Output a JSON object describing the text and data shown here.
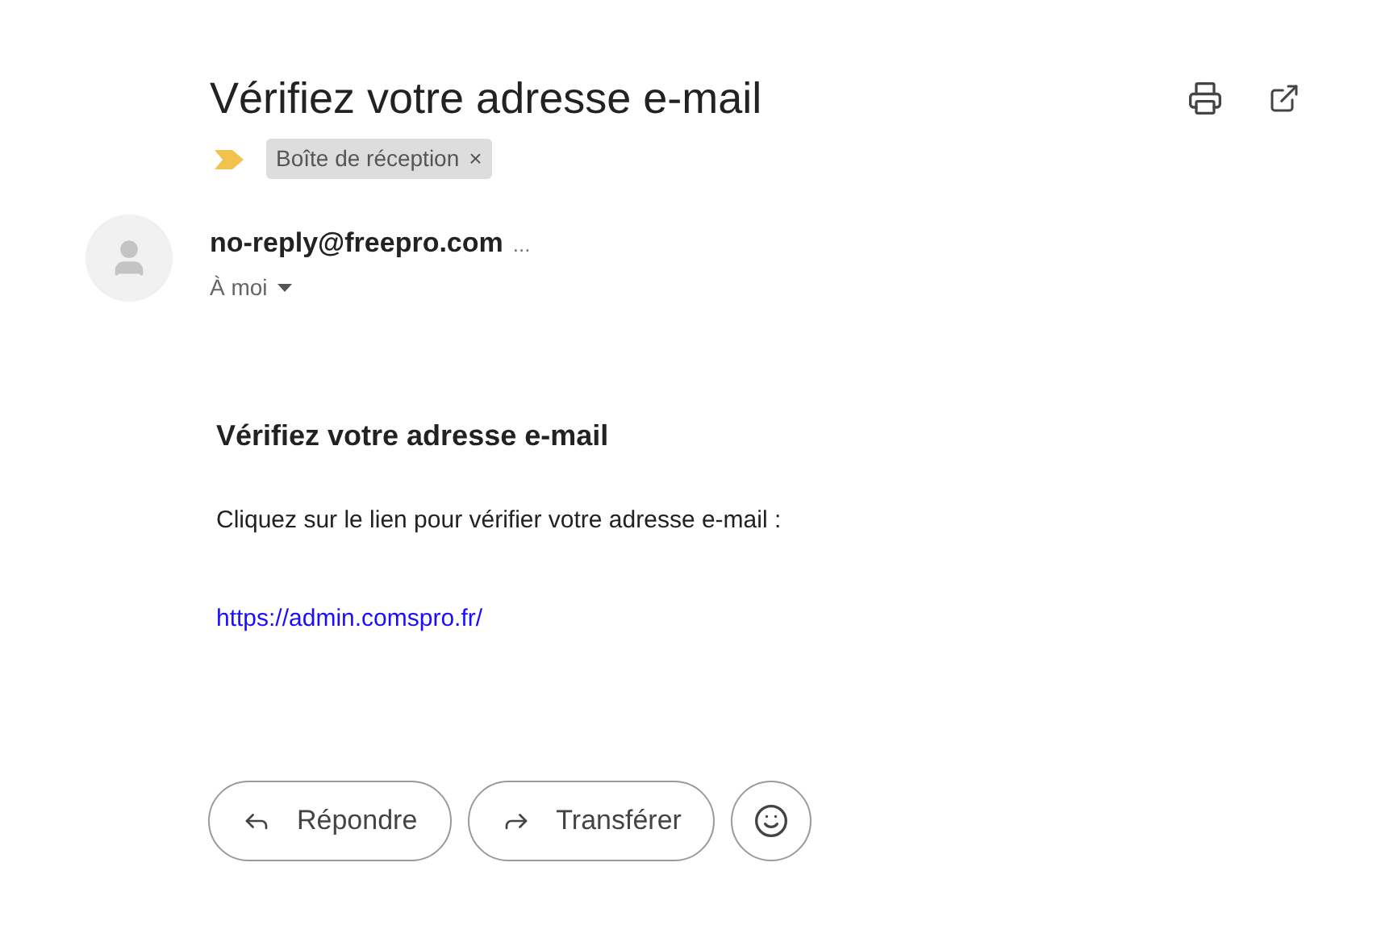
{
  "subject": "Vérifiez votre adresse e-mail",
  "label": {
    "text": "Boîte de réception",
    "remove": "×"
  },
  "sender": {
    "address": "no-reply@freepro.com",
    "more": "...",
    "recipient": "À moi"
  },
  "body": {
    "heading": "Vérifiez votre adresse e-mail",
    "text": "Cliquez sur le lien pour vérifier votre adresse e-mail :",
    "link": "https://admin.comspro.fr/"
  },
  "actions": [
    {
      "kind": "reply",
      "label": "Répondre"
    },
    {
      "kind": "forward",
      "label": "Transférer"
    },
    {
      "kind": "emoji"
    }
  ]
}
